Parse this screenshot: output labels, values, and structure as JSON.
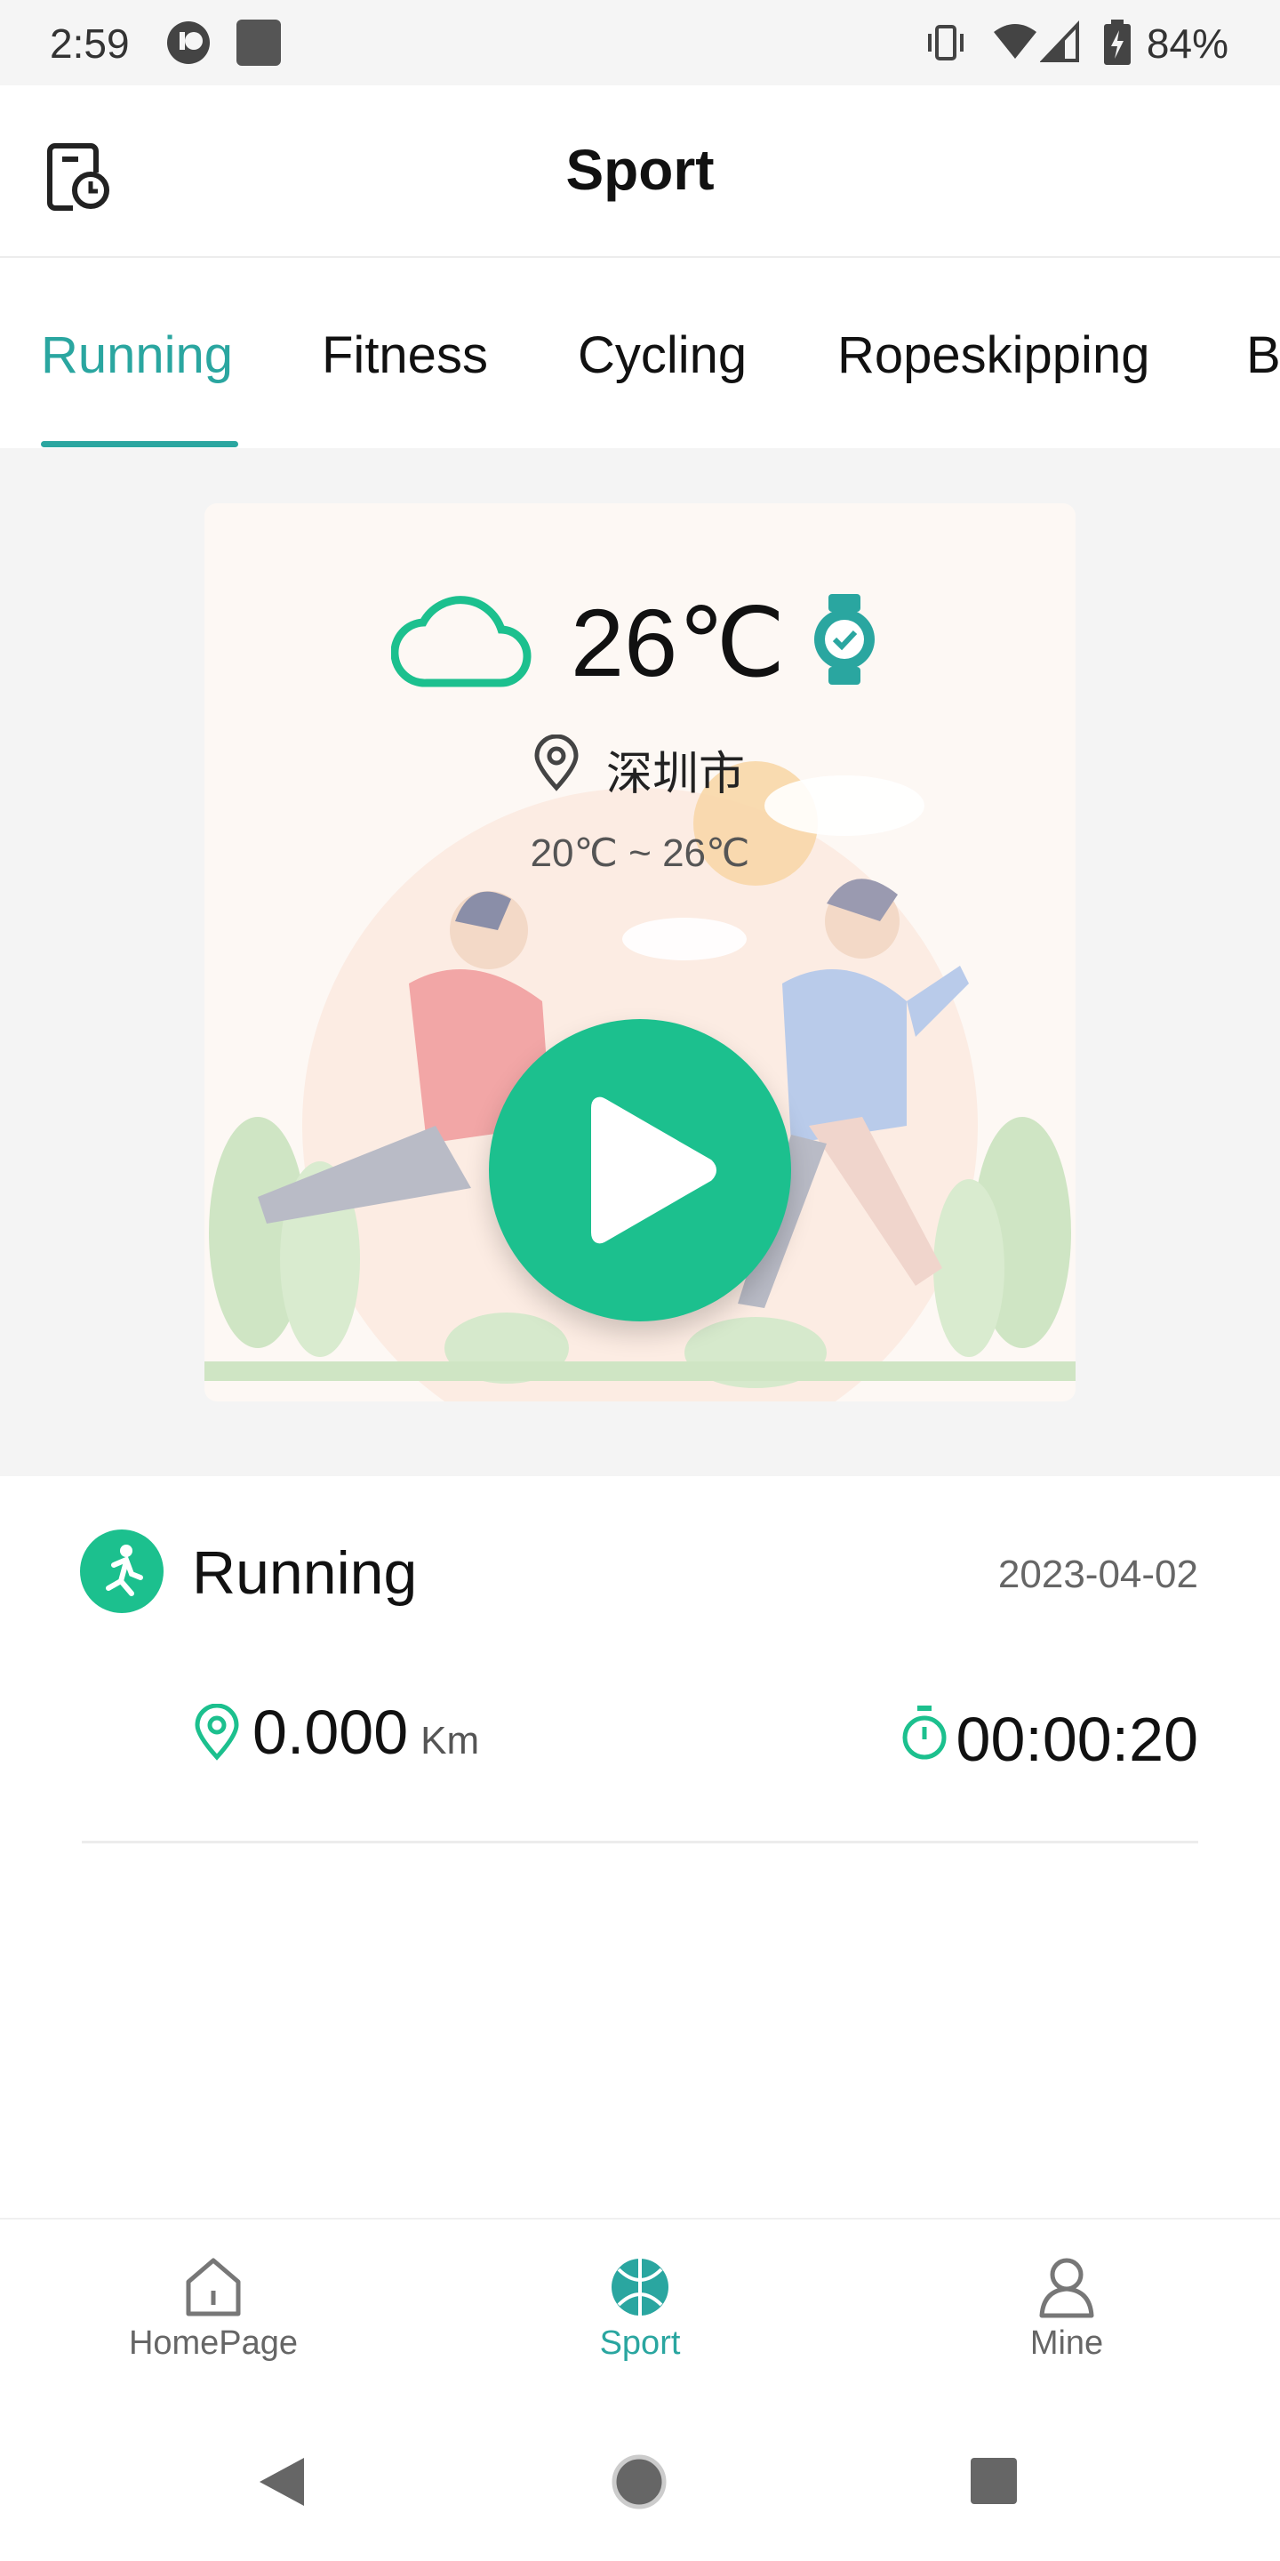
{
  "status_bar": {
    "time": "2:59",
    "battery": "84%"
  },
  "header": {
    "title": "Sport"
  },
  "tabs": [
    {
      "label": "Running",
      "active": true
    },
    {
      "label": "Fitness",
      "active": false
    },
    {
      "label": "Cycling",
      "active": false
    },
    {
      "label": "Ropeskipping",
      "active": false
    },
    {
      "label": "B",
      "active": false
    }
  ],
  "weather": {
    "temperature": "26℃",
    "city": "深圳市",
    "range": "20℃ ~ 26℃"
  },
  "record": {
    "title": "Running",
    "date": "2023-04-02",
    "distance": "0.000",
    "distance_unit": "Km",
    "duration": "00:00:20"
  },
  "bottom_nav": [
    {
      "label": "HomePage",
      "active": false
    },
    {
      "label": "Sport",
      "active": true
    },
    {
      "label": "Mine",
      "active": false
    }
  ],
  "colors": {
    "accent": "#2aa6a0",
    "play": "#1cc08e",
    "background": "#f4f4f4"
  }
}
